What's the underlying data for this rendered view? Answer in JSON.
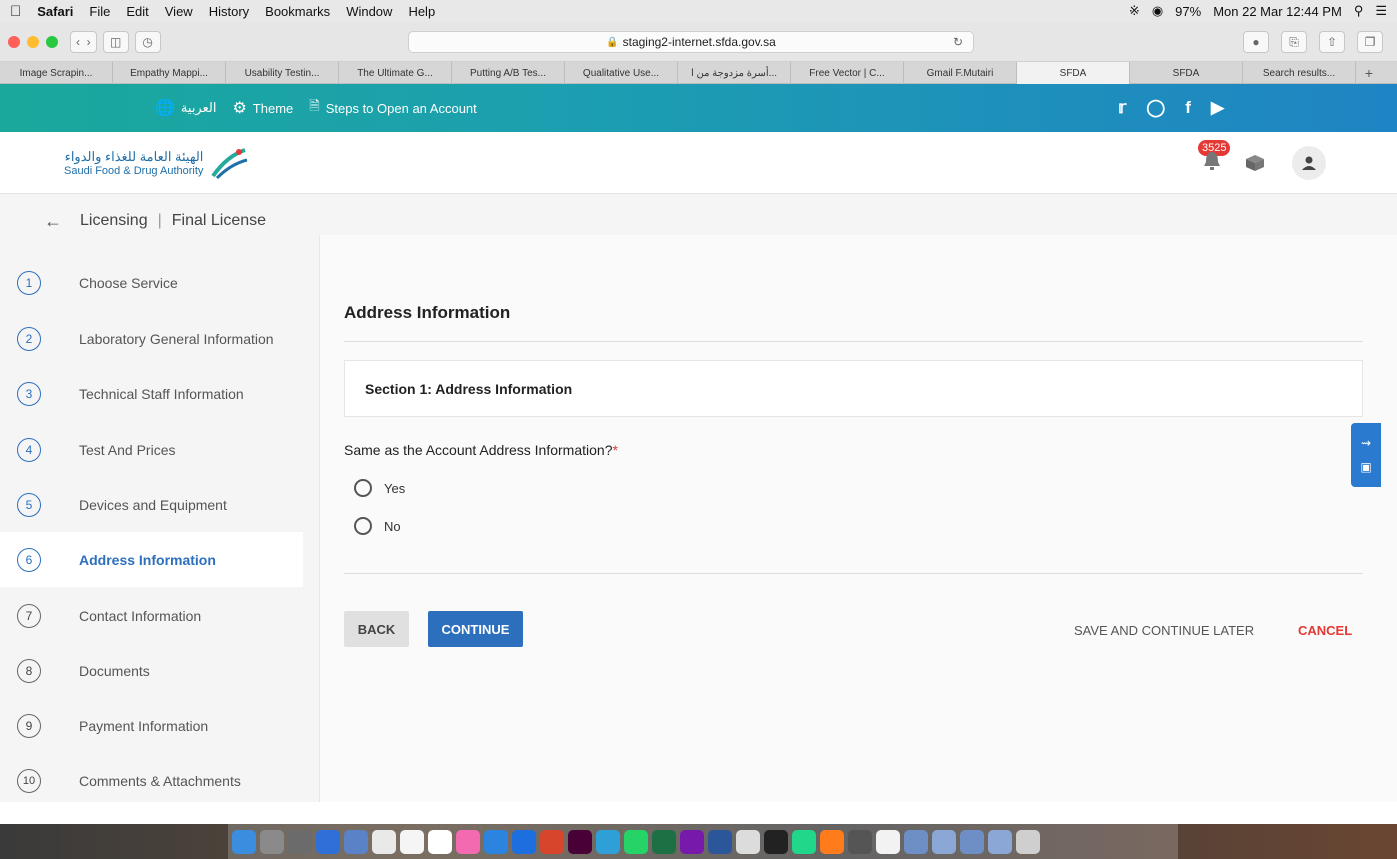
{
  "menubar": {
    "app": "Safari",
    "items": [
      "File",
      "Edit",
      "View",
      "History",
      "Bookmarks",
      "Window",
      "Help"
    ],
    "battery": "97%",
    "clock": "Mon 22 Mar  12:44 PM"
  },
  "browser": {
    "url": "staging2-internet.sfda.gov.sa",
    "tabs": [
      "Image Scrapin...",
      "Empathy Mappi...",
      "Usability Testin...",
      "The Ultimate G...",
      "Putting A/B Tes...",
      "Qualitative Use...",
      "أسرة مزدوجة من ا...",
      "Free Vector | C...",
      "Gmail F.Mutairi",
      "SFDA",
      "SFDA",
      "Search results..."
    ]
  },
  "topstrip": {
    "arabic_label": "العربية",
    "theme_label": "Theme",
    "steps_label": "Steps to Open an Account"
  },
  "brand": {
    "logo_ar": "الهيئة العامة للغذاء والدواء",
    "logo_en": "Saudi Food & Drug Authority",
    "notifications": "3525"
  },
  "breadcrumb": {
    "section": "Licensing",
    "page": "Final License"
  },
  "steps": [
    {
      "num": "1",
      "label": "Choose Service"
    },
    {
      "num": "2",
      "label": "Laboratory General Information"
    },
    {
      "num": "3",
      "label": "Technical Staff Information"
    },
    {
      "num": "4",
      "label": "Test And Prices"
    },
    {
      "num": "5",
      "label": "Devices and Equipment"
    },
    {
      "num": "6",
      "label": "Address Information"
    },
    {
      "num": "7",
      "label": "Contact Information"
    },
    {
      "num": "8",
      "label": "Documents"
    },
    {
      "num": "9",
      "label": "Payment Information"
    },
    {
      "num": "10",
      "label": "Comments & Attachments"
    }
  ],
  "form": {
    "title": "Address Information",
    "section": "Section 1: Address Information",
    "question": "Same as the Account Address Information?",
    "required_mark": "*",
    "options": [
      "Yes",
      "No"
    ],
    "back": "BACK",
    "continue": "CONTINUE",
    "save_later": "SAVE AND CONTINUE LATER",
    "cancel": "CANCEL"
  },
  "colors": {
    "primary": "#2c6fbd",
    "danger": "#e53935",
    "header_start": "#1aa89c",
    "header_end": "#1f84c4"
  }
}
